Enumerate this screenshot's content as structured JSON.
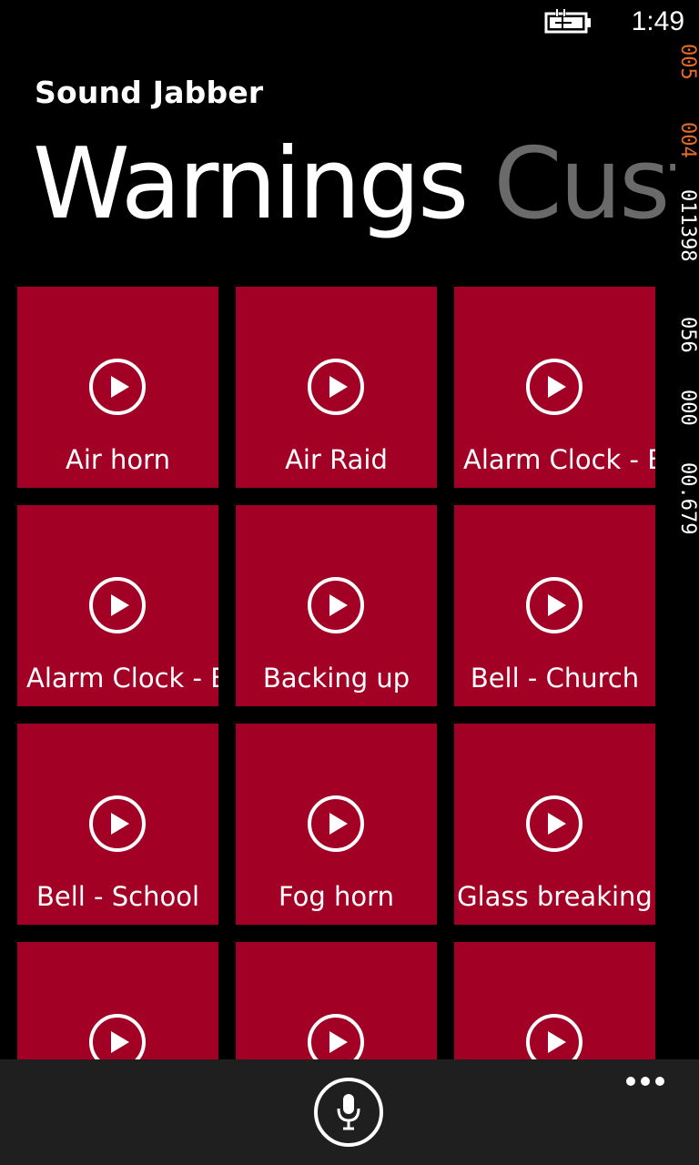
{
  "status_bar": {
    "time": "1:49",
    "battery_icon": "battery-charging-icon"
  },
  "frame_counter": {
    "lines": [
      "005",
      "004",
      "011398",
      "056",
      "000",
      "00.679"
    ]
  },
  "app": {
    "title": "Sound Jabber"
  },
  "pivot": {
    "tabs": [
      {
        "label": "Warnings",
        "active": true
      },
      {
        "label": "Custom",
        "active": false
      }
    ]
  },
  "tiles": [
    {
      "label": "Air horn",
      "icon": "play-icon"
    },
    {
      "label": "Air Raid",
      "icon": "play-icon"
    },
    {
      "label": "Alarm Clock - Buzzer",
      "icon": "play-icon"
    },
    {
      "label": "Alarm Clock - Bell",
      "icon": "play-icon"
    },
    {
      "label": "Backing up",
      "icon": "play-icon"
    },
    {
      "label": "Bell - Church",
      "icon": "play-icon"
    },
    {
      "label": "Bell - School",
      "icon": "play-icon"
    },
    {
      "label": "Fog horn",
      "icon": "play-icon"
    },
    {
      "label": "Glass breaking",
      "icon": "play-icon"
    },
    {
      "label": "",
      "icon": "play-icon"
    },
    {
      "label": "",
      "icon": "play-icon"
    },
    {
      "label": "",
      "icon": "play-icon"
    }
  ],
  "app_bar": {
    "primary_icon": "microphone-icon",
    "more_icon": "more-options-icon"
  },
  "colors": {
    "tile_background": "#a20025",
    "background": "#000000",
    "app_bar_background": "#1f1f1f",
    "inactive_pivot": "#6a6a6a"
  }
}
